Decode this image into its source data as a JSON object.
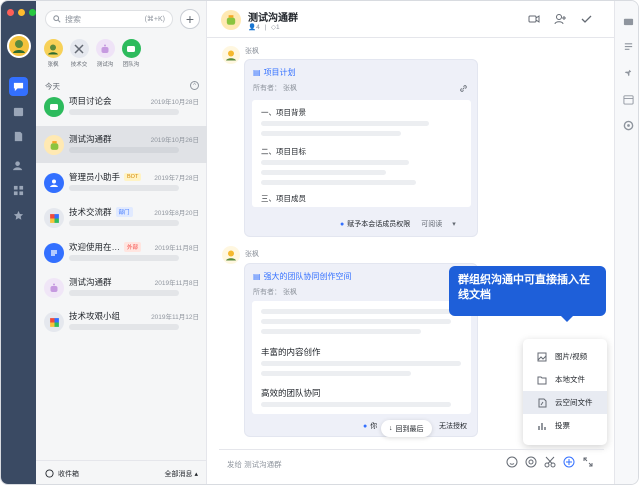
{
  "colors": {
    "rail": "#3a4a63",
    "accent": "#3370ff",
    "tip": "#1e5fd9"
  },
  "search": {
    "placeholder": "搜索",
    "shortcut": "(⌘+K)"
  },
  "pins": [
    {
      "label": "张枫",
      "icon": "person-avatar"
    },
    {
      "label": "技术交",
      "icon": "tools-icon"
    },
    {
      "label": "测试沟",
      "icon": "robot-avatar"
    },
    {
      "label": "团队沟",
      "icon": "group-chat-icon"
    }
  ],
  "section": {
    "today": "今天"
  },
  "conversations": [
    {
      "title": "项目讨论会",
      "time": "2019年10月28日",
      "tag": "",
      "icon": "group-chat-icon",
      "color": "#2dbb5d"
    },
    {
      "title": "测试沟通群",
      "time": "2019年10月26日",
      "tag": "",
      "icon": "robot-avatar",
      "color": "#ffe9b3"
    },
    {
      "title": "管理员小助手",
      "time": "2019年7月28日",
      "tag": "BOT",
      "icon": "assistant-icon",
      "color": "#3370ff"
    },
    {
      "title": "技术交流群",
      "time": "2019年8月20日",
      "tag": "部门",
      "icon": "tech-group-icon",
      "color": "#e5e8ee"
    },
    {
      "title": "欢迎使用在…",
      "time": "2019年11月8日",
      "tag": "外部",
      "icon": "doc-list-icon",
      "color": "#3370ff"
    },
    {
      "title": "测试沟通群",
      "time": "2019年11月8日",
      "tag": "",
      "icon": "robot-avatar",
      "color": "#f0e6f7"
    },
    {
      "title": "技术攻艰小组",
      "time": "2019年11月12日",
      "tag": "",
      "icon": "tech-group-icon",
      "color": "#e5e8ee"
    }
  ],
  "footer": {
    "inbox": "收件箱",
    "all": "全部消息",
    "arrow": "▴"
  },
  "chat": {
    "title": "测试沟通群",
    "members": "4",
    "pinned": "1"
  },
  "messages": [
    {
      "sender": "张枫",
      "doc_title": "项目计划",
      "owner": "所有者：  张枫",
      "headings": [
        "一、项目背景",
        "二、项目目标",
        "三、项目成员"
      ],
      "permission": "赋予本会话成员权限",
      "access": "可阅读"
    },
    {
      "sender": "张枫",
      "doc_title": "强大的团队协同创作空间",
      "owner": "所有者：  张枫",
      "headings": [
        "丰富的内容创作",
        "高效的团队协同"
      ],
      "permission_fragment": "你",
      "access_fragment": "无法授权"
    }
  ],
  "tooltip": "群组织沟通中可直接插入在线文档",
  "attach_menu": [
    {
      "label": "图片/视频",
      "icon": "image-icon"
    },
    {
      "label": "本地文件",
      "icon": "folder-icon"
    },
    {
      "label": "云空间文件",
      "icon": "cloud-doc-icon"
    },
    {
      "label": "投票",
      "icon": "poll-icon"
    }
  ],
  "back_to_latest": "回到最后",
  "input": {
    "placeholder": "发给 测试沟通群"
  }
}
